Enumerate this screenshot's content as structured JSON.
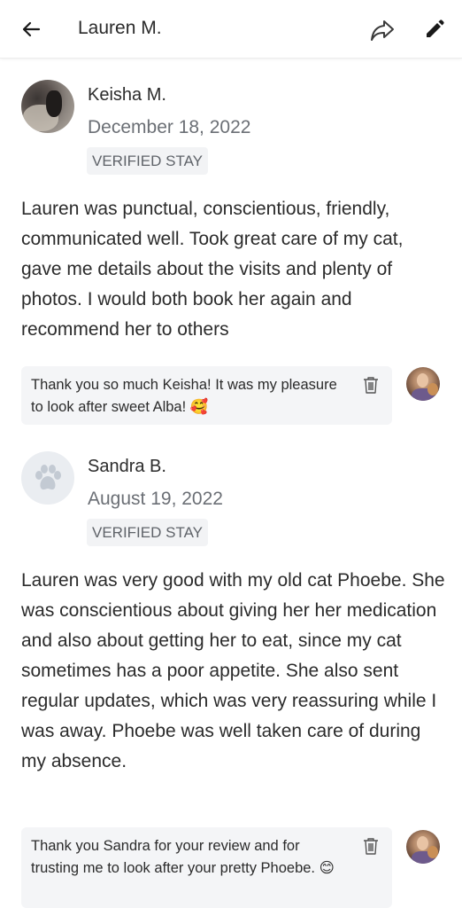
{
  "header": {
    "title": "Lauren M.",
    "back_icon": "arrow-left-icon",
    "share_icon": "share-icon",
    "edit_icon": "pencil-icon"
  },
  "reviews": [
    {
      "reviewer_name": "Keisha M.",
      "date": "December 18, 2022",
      "badge": "VERIFIED STAY",
      "avatar": "cat-photo",
      "text": "Lauren was punctual, conscientious, friendly, communicated well. Took great care of my cat, gave me details about the visits and plenty of photos. I would both book her again and recommend her to others",
      "reply": {
        "text": "Thank you so much Keisha! It was my pleasure to look after sweet Alba! 🥰",
        "delete_icon": "trash-icon"
      }
    },
    {
      "reviewer_name": "Sandra B.",
      "date": "August 19, 2022",
      "badge": "VERIFIED STAY",
      "avatar": "paw-placeholder",
      "text": "Lauren was very good with my old cat Phoebe. She was conscientious about giving her her medication and also about getting her to eat, since my cat sometimes has a poor appetite. She also sent regular updates, which was very reassuring while I was away. Phoebe was well taken care of during my absence.",
      "reply": {
        "text": "Thank you Sandra for your review and for trusting me to look after your pretty Phoebe. 😊",
        "delete_icon": "trash-icon"
      }
    }
  ],
  "colors": {
    "text_primary": "#2b2b2b",
    "text_secondary": "#6b6f75",
    "badge_bg": "#f2f3f5",
    "reply_bg": "#f4f5f7"
  }
}
